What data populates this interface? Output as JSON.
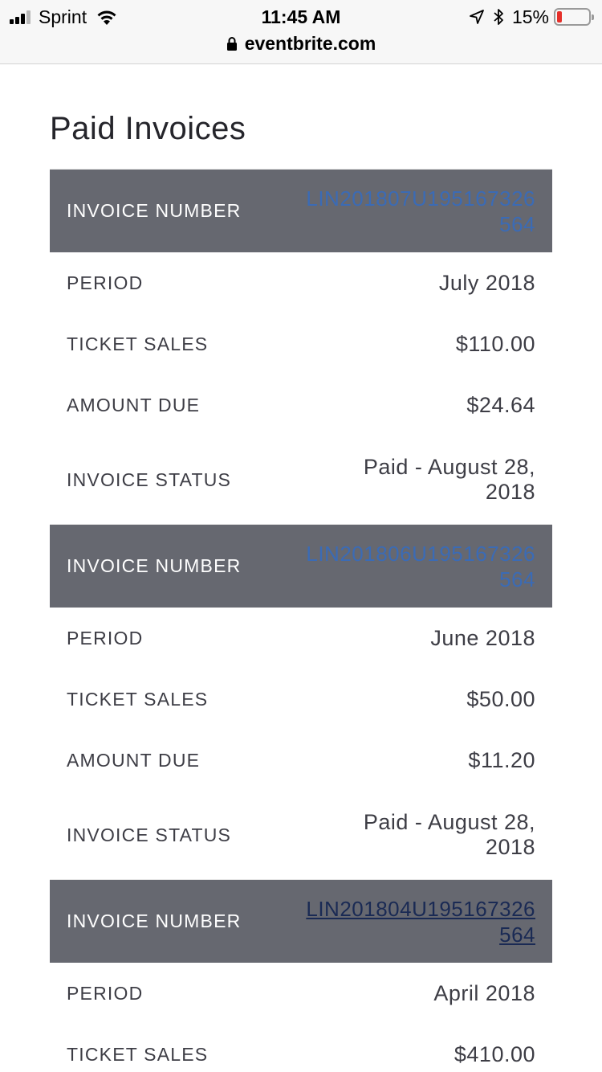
{
  "status_bar": {
    "carrier": "Sprint",
    "time": "11:45 AM",
    "battery_percent": "15%",
    "battery_color": "#e5302a"
  },
  "browser": {
    "url": "eventbrite.com"
  },
  "page": {
    "title": "Paid Invoices"
  },
  "labels": {
    "invoice_number": "INVOICE NUMBER",
    "period": "PERIOD",
    "ticket_sales": "TICKET SALES",
    "amount_due": "AMOUNT DUE",
    "invoice_status": "INVOICE STATUS"
  },
  "invoices": [
    {
      "number": "LIN201807U195167326564",
      "period": "July 2018",
      "ticket_sales": "$110.00",
      "amount_due": "$24.64",
      "status": "Paid - August 28, 2018"
    },
    {
      "number": "LIN201806U195167326564",
      "period": "June 2018",
      "ticket_sales": "$50.00",
      "amount_due": "$11.20",
      "status": "Paid - August 28, 2018"
    },
    {
      "number": "LIN201804U195167326564",
      "period": "April 2018",
      "ticket_sales": "$410.00"
    }
  ],
  "colors": {
    "header_row_bg": "#666870",
    "link": "#3b6bb5",
    "visited_link": "#1a2a54"
  }
}
